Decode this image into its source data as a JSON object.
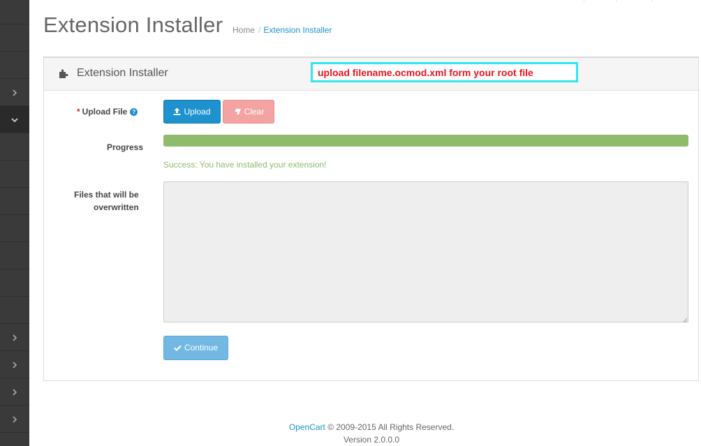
{
  "header": {
    "title": "Extension Installer",
    "breadcrumb": [
      "Home",
      "Extension Installer"
    ]
  },
  "sidebar": {
    "items": [
      {
        "icon": "none"
      },
      {
        "icon": "none"
      },
      {
        "icon": "chevron-right-icon"
      },
      {
        "icon": "chevron-down-icon",
        "state": "open"
      },
      {
        "icon": "none"
      },
      {
        "icon": "none"
      },
      {
        "icon": "none"
      },
      {
        "icon": "none"
      },
      {
        "icon": "none"
      },
      {
        "icon": "none"
      },
      {
        "icon": "none"
      },
      {
        "icon": "none"
      },
      {
        "icon": "chevron-right-icon"
      },
      {
        "icon": "chevron-right-icon"
      },
      {
        "icon": "chevron-right-icon"
      },
      {
        "icon": "chevron-right-icon"
      }
    ]
  },
  "panel": {
    "title": "Extension Installer",
    "icon": "puzzle-icon"
  },
  "annotation": {
    "text": "upload filename.ocmod.xml form your root file",
    "border_color": "#33e6ec",
    "text_color": "#e8141e"
  },
  "form": {
    "required_mark": "*",
    "upload_label": "Upload File",
    "upload_button": "Upload",
    "clear_button": "Clear",
    "progress_label": "Progress",
    "progress_percent": 100,
    "success_message": "Success: You have installed your extension!",
    "files_label_line1": "Files that will be",
    "files_label_line2": "overwritten",
    "files_value": "",
    "continue_button": "Continue"
  },
  "footer": {
    "brand": "OpenCart",
    "copyright": " © 2009-2015 All Rights Reserved.",
    "version": "Version 2.0.0.0"
  },
  "colors": {
    "primary": "#1e91cf",
    "danger_light": "#f4a3a3",
    "success": "#8fbb6c",
    "sidebar": "#3a3a3a"
  }
}
